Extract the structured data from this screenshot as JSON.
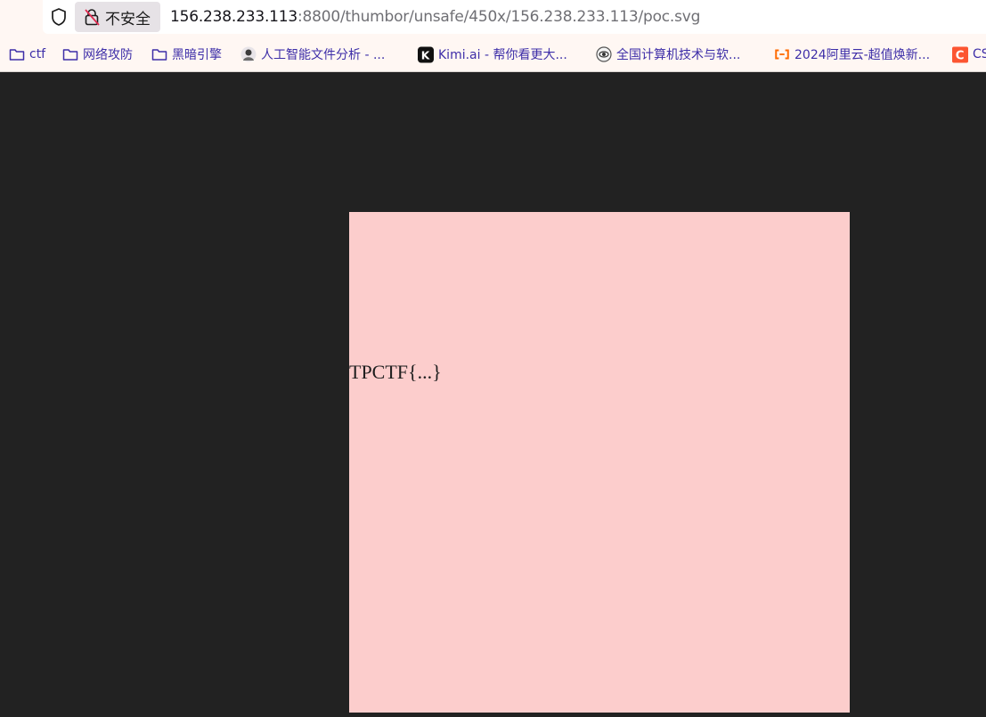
{
  "browser": {
    "security_label": "不安全",
    "url_host": "156.238.233.113",
    "url_rest": ":8800/thumbor/unsafe/450x/156.238.233.113/poc.svg"
  },
  "bookmarks": [
    {
      "label": "ctf",
      "icon": "folder-icon"
    },
    {
      "label": "网络攻防",
      "icon": "folder-icon"
    },
    {
      "label": "黑暗引擎",
      "icon": "folder-icon"
    },
    {
      "label": "人工智能文件分析 - ...",
      "icon": "avatar-icon"
    },
    {
      "label": "Kimi.ai - 帮你看更大...",
      "icon": "kimi-icon"
    },
    {
      "label": "全国计算机技术与软...",
      "icon": "globe-icon"
    },
    {
      "label": "2024阿里云-超值焕新...",
      "icon": "aliyun-icon"
    },
    {
      "label": "CS",
      "icon": "csdn-icon"
    }
  ],
  "content": {
    "image_text": "TPCTF{...}",
    "image_background": "#fccdcc",
    "page_background": "#222222"
  }
}
